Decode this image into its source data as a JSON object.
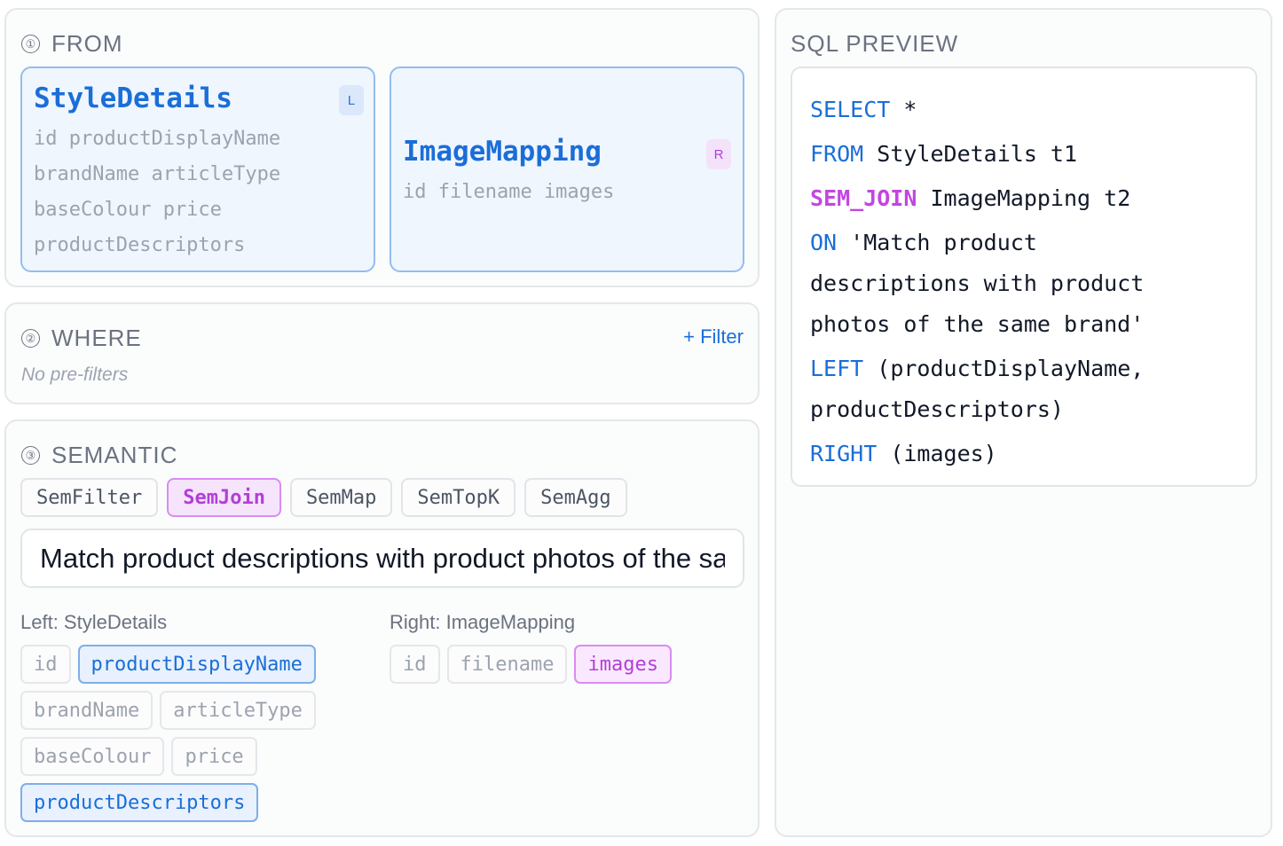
{
  "from": {
    "step": "①",
    "title": "FROM",
    "tables": [
      {
        "name": "StyleDetails",
        "badge": "L",
        "columns_text": "id productDisplayName brandName articleType baseColour price productDescriptors"
      },
      {
        "name": "ImageMapping",
        "badge": "R",
        "columns_text": "id filename images"
      }
    ]
  },
  "where": {
    "step": "②",
    "title": "WHERE",
    "add_filter_label": "+ Filter",
    "empty_text": "No pre-filters"
  },
  "semantic": {
    "step": "③",
    "title": "SEMANTIC",
    "operators": [
      "SemFilter",
      "SemJoin",
      "SemMap",
      "SemTopK",
      "SemAgg"
    ],
    "active_operator": "SemJoin",
    "predicate_value": "Match product descriptions with product photos of the same brand",
    "left_label": "Left: StyleDetails",
    "right_label": "Right: ImageMapping",
    "left_columns": [
      "id",
      "productDisplayName",
      "brandName",
      "articleType",
      "baseColour",
      "price",
      "productDescriptors"
    ],
    "left_selected": [
      "productDisplayName",
      "productDescriptors"
    ],
    "right_columns": [
      "id",
      "filename",
      "images"
    ],
    "right_selected": [
      "images"
    ]
  },
  "sql_preview": {
    "title": "SQL PREVIEW",
    "select_kw": "SELECT",
    "select_rest": " *",
    "from_kw": "FROM",
    "from_rest": " StyleDetails t1",
    "join_kw": "SEM_JOIN",
    "join_rest": " ImageMapping t2",
    "on_kw": "ON",
    "on_rest_1": " 'Match product",
    "on_rest_2": "descriptions with product",
    "on_rest_3": "photos of the same brand'",
    "left_kw": "LEFT",
    "left_rest_1": " (productDisplayName,",
    "left_rest_2": "productDescriptors)",
    "right_kw": "RIGHT",
    "right_rest": " (images)"
  },
  "colors": {
    "accent_blue": "#1b6ed8",
    "accent_purple": "#b23fd6",
    "muted": "#9ca3af"
  }
}
